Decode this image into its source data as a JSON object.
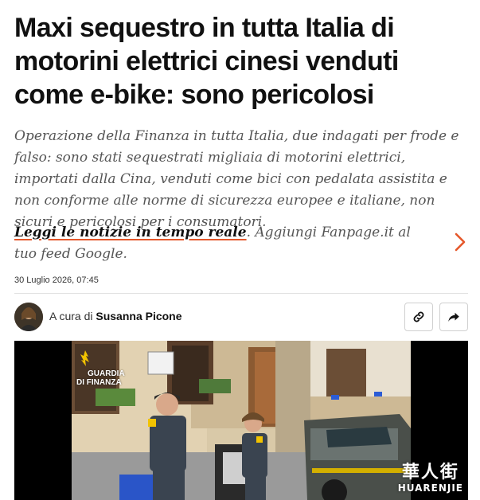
{
  "article": {
    "headline": "Maxi sequestro in tutta Italia di motorini elettrici cinesi venduti come e-bike: sono pericolosi",
    "summary": "Operazione della Finanza in tutta Italia, due indagati per frode e falso: sono stati sequestrati migliaia di motorini elettrici, importati dalla Cina, venduti come bici con pedalata assistita e non conforme alle norme di sicurezza europee e italiane, non sicuri e pericolosi per i consumatori.",
    "date": "30 Luglio 2026, 07:45"
  },
  "feed_promo": {
    "link_text": "Leggi le notizie in tempo reale",
    "rest_text": ". Aggiungi Fanpage.it al tuo feed Google."
  },
  "byline": {
    "prefix": "A cura di",
    "author": "Susanna Picone"
  },
  "share": {
    "copy_link_icon": "link-icon",
    "share_icon": "share-arrow-icon"
  },
  "media": {
    "badge_line1": "GUARDIA",
    "badge_line2": "DI FINANZA",
    "watermark_cn": "華人街",
    "watermark_en": "HUARENJIE"
  },
  "colors": {
    "accent": "#e5572a",
    "text": "#111111",
    "muted": "#555555"
  }
}
